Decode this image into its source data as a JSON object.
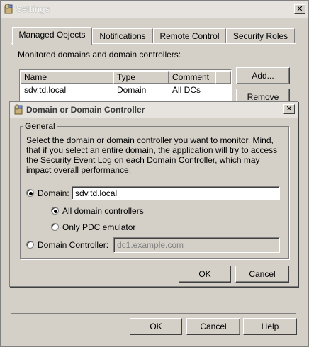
{
  "settings": {
    "title": "Settings",
    "close": "✕",
    "tabs": [
      {
        "label": "Managed Objects"
      },
      {
        "label": "Notifications"
      },
      {
        "label": "Remote Control"
      },
      {
        "label": "Security Roles"
      }
    ],
    "monitored_label": "Monitored domains and domain controllers:",
    "table": {
      "columns": [
        "Name",
        "Type",
        "Comment"
      ],
      "rows": [
        {
          "name": "sdv.td.local",
          "type": "Domain",
          "comment": "All DCs"
        }
      ]
    },
    "add_button": "Add...",
    "remove_button": "Remove",
    "ok_button": "OK",
    "cancel_button": "Cancel",
    "help_button": "Help"
  },
  "dialog": {
    "title": "Domain or Domain Controller",
    "close": "✕",
    "group_label": "General",
    "description": "Select the domain or domain controller you want to monitor. Mind, that if you select an entire domain, the application will try to access the Security Event Log on each Domain Controller, which may impact overall performance.",
    "domain_option": "Domain:",
    "domain_value": "sdv.td.local",
    "all_dc_option": "All domain controllers",
    "pdc_option": "Only PDC emulator",
    "dc_option": "Domain Controller:",
    "dc_placeholder": "dc1.example.com",
    "ok_button": "OK",
    "cancel_button": "Cancel"
  }
}
